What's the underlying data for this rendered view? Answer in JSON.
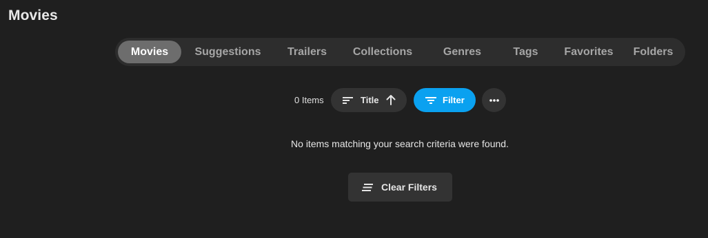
{
  "header": {
    "title": "Movies"
  },
  "tabs": [
    {
      "label": "Movies",
      "active": true
    },
    {
      "label": "Suggestions",
      "active": false
    },
    {
      "label": "Trailers",
      "active": false
    },
    {
      "label": "Collections",
      "active": false
    },
    {
      "label": "Genres",
      "active": false
    },
    {
      "label": "Tags",
      "active": false
    },
    {
      "label": "Favorites",
      "active": false
    },
    {
      "label": "Folders",
      "active": false
    }
  ],
  "toolbar": {
    "items_count": "0 Items",
    "sort": {
      "label": "Title",
      "icon": "sort-lines-icon",
      "direction_icon": "arrow-up-icon"
    },
    "filter": {
      "label": "Filter",
      "icon": "filter-icon"
    },
    "more_icon": "more-horizontal-icon"
  },
  "empty_state": {
    "message": "No items matching your search criteria were found.",
    "clear_button_label": "Clear Filters",
    "clear_button_icon": "clear-filter-icon"
  },
  "colors": {
    "background": "#1f1f1f",
    "tabbar": "#2d2d2d",
    "active_tab": "#6d6d6d",
    "accent": "#0aa1f0",
    "button": "#333333"
  }
}
